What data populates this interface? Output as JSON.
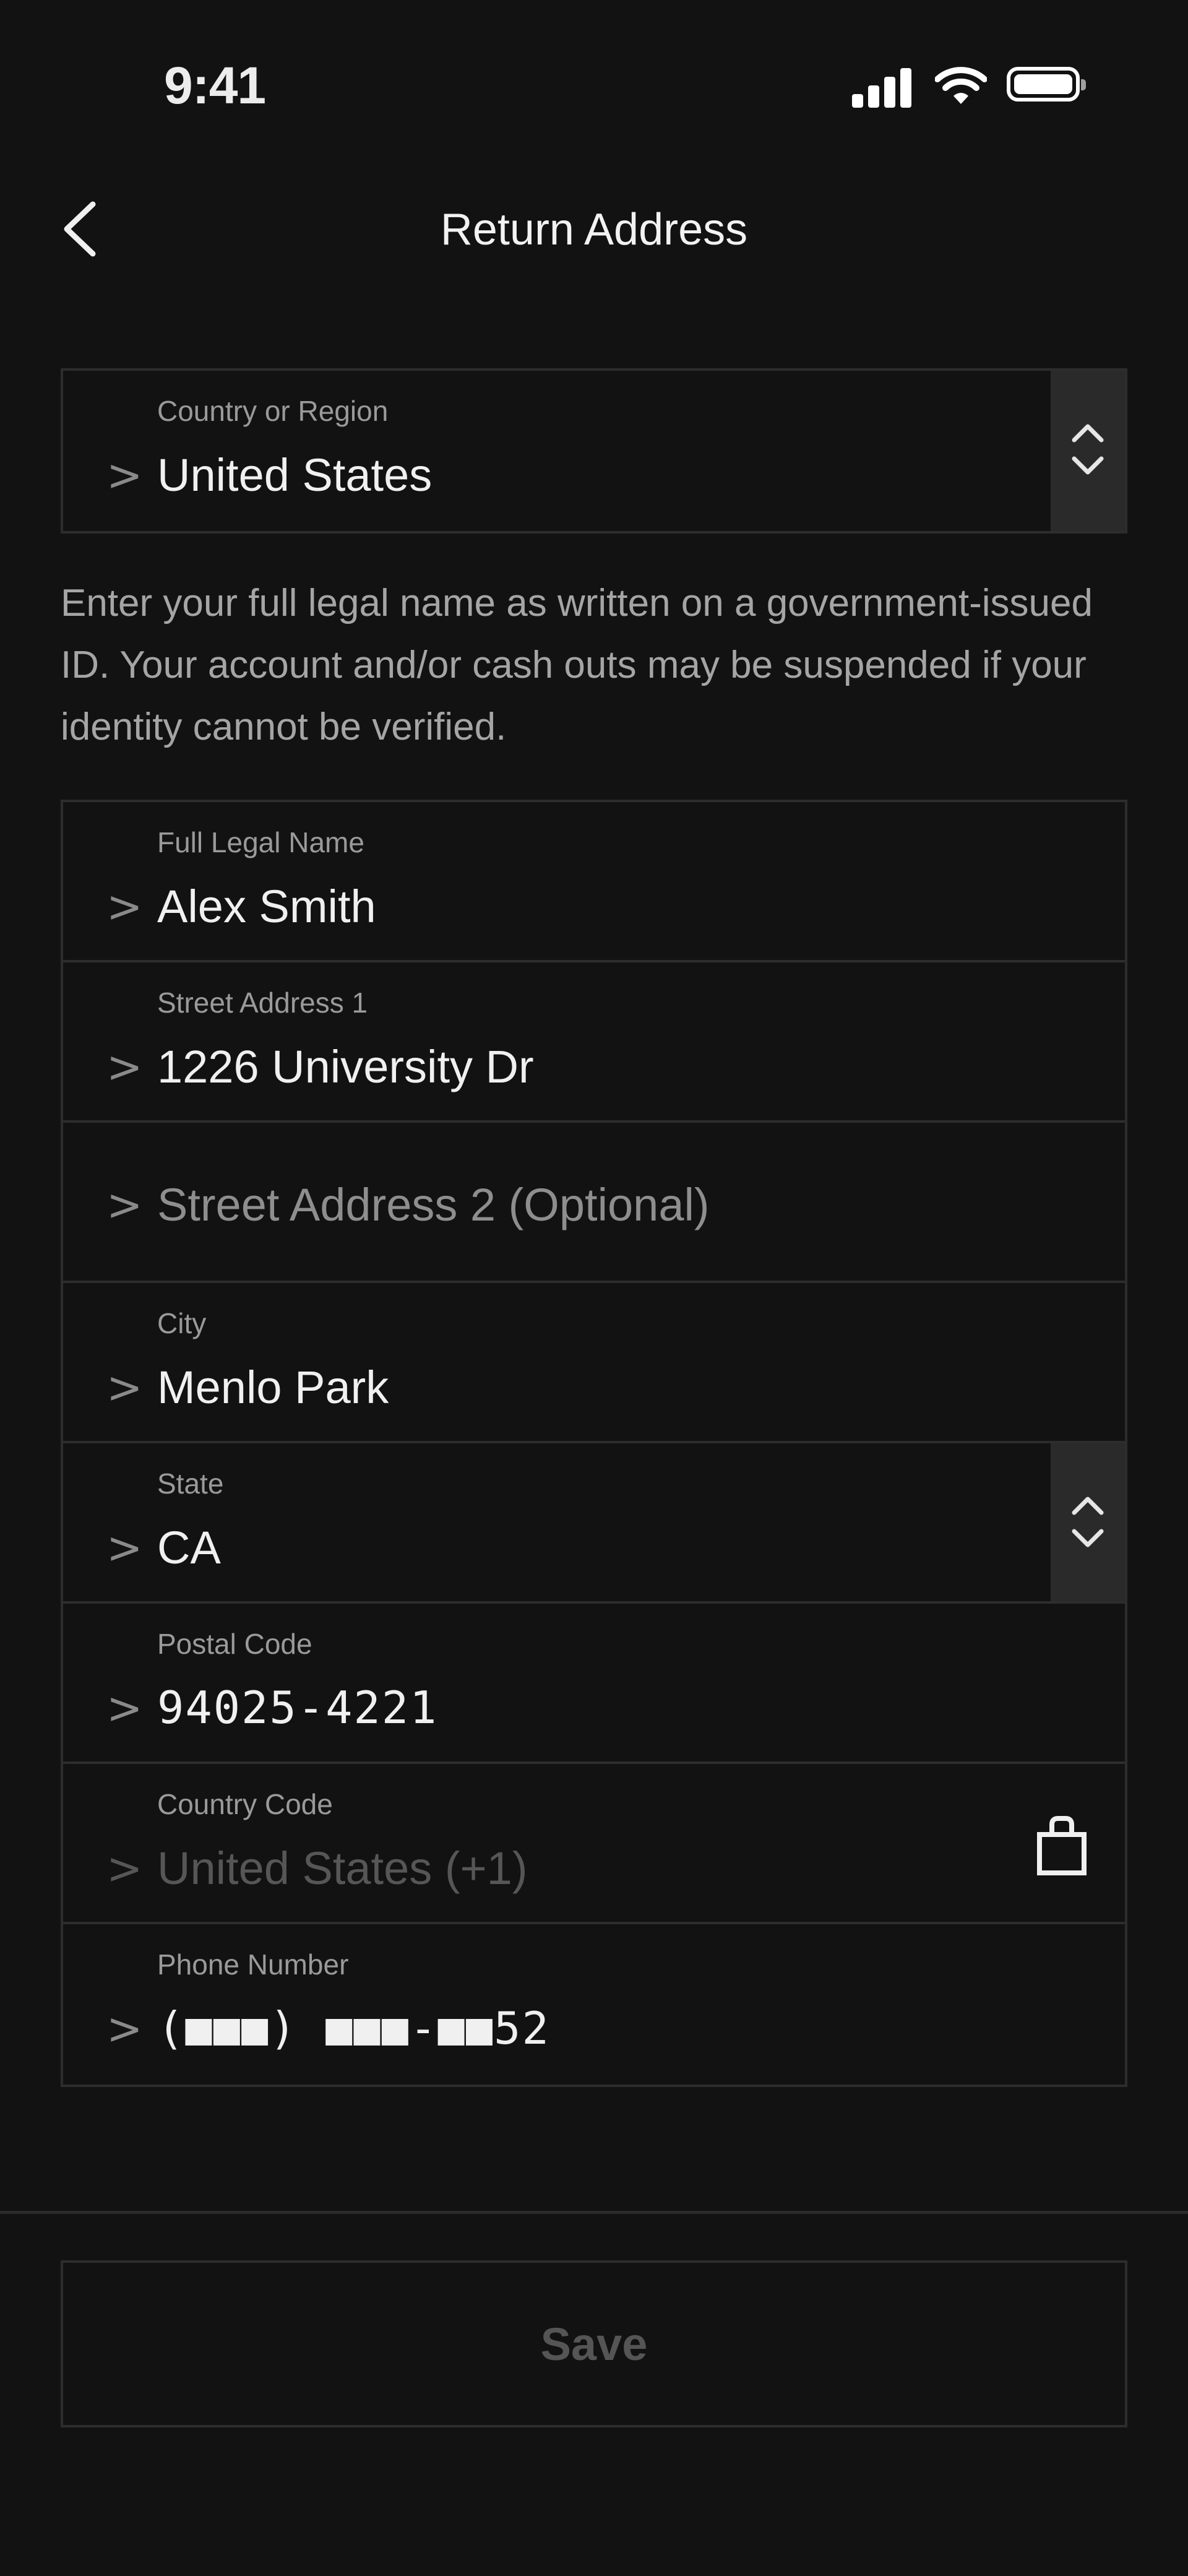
{
  "status_bar": {
    "time": "9:41",
    "icons": [
      "signal-icon",
      "wifi-icon",
      "battery-icon"
    ]
  },
  "nav": {
    "back_icon": "chevron-left-icon",
    "title": "Return Address"
  },
  "country_field": {
    "label": "Country or Region",
    "caret": ">",
    "value": "United States",
    "select_icon": "chevron-up-down-icon"
  },
  "helper_text": "Enter your full legal name as written on a government-issued ID. Your account and/or cash outs may be suspended if your identity cannot be verified.",
  "form": {
    "full_name": {
      "label": "Full Legal Name",
      "caret": ">",
      "value": "Alex Smith"
    },
    "street1": {
      "label": "Street Address 1",
      "caret": ">",
      "value": "1226 University Dr"
    },
    "street2": {
      "caret": ">",
      "placeholder": "Street Address 2 (Optional)"
    },
    "city": {
      "label": "City",
      "caret": ">",
      "value": "Menlo Park"
    },
    "state": {
      "label": "State",
      "caret": ">",
      "value": "CA",
      "select_icon": "chevron-up-down-icon"
    },
    "postal_code": {
      "label": "Postal Code",
      "caret": ">",
      "value": "94025-4221"
    },
    "country_code": {
      "label": "Country Code",
      "caret": ">",
      "value": "United States (+1)",
      "icon": "lock-icon"
    },
    "phone": {
      "label": "Phone Number",
      "caret": ">",
      "value": "(■■■) ■■■-■■52"
    }
  },
  "save_button": {
    "label": "Save"
  },
  "colors": {
    "background": "#121212",
    "border": "#2d2d2d",
    "select_bg": "#2a2a2a",
    "text": "#f0f0f0",
    "label": "#9a9a9a",
    "disabled": "#565656"
  }
}
